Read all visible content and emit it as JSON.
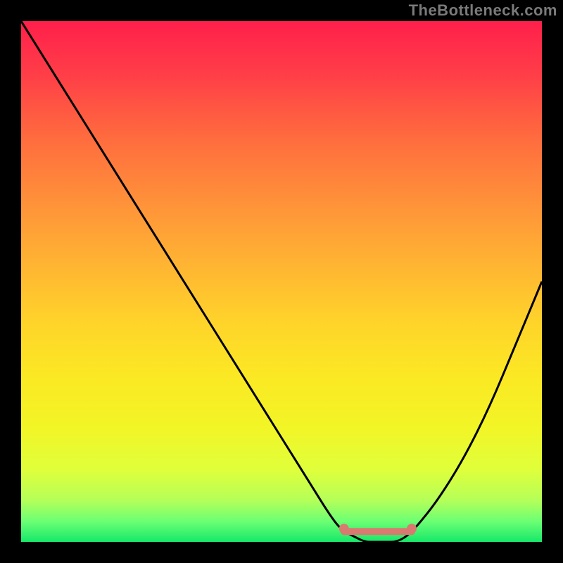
{
  "attribution": "TheBottleneck.com",
  "chart_data": {
    "type": "line",
    "title": "",
    "xlabel": "",
    "ylabel": "",
    "xlim": [
      0,
      100
    ],
    "ylim": [
      0,
      100
    ],
    "x": [
      0,
      5,
      10,
      15,
      20,
      25,
      30,
      35,
      40,
      45,
      50,
      55,
      60,
      62,
      64,
      66,
      68,
      70,
      72,
      74,
      76,
      80,
      85,
      90,
      95,
      100
    ],
    "values": [
      100,
      92,
      84,
      76,
      68,
      60,
      52,
      44,
      36,
      28,
      20,
      12,
      4,
      2,
      1,
      0,
      0,
      0,
      0,
      1,
      3,
      8,
      16,
      26,
      38,
      50
    ],
    "optimal_range": {
      "start": 62,
      "end": 75,
      "value": 2
    },
    "background": "rainbow-vertical-gradient",
    "annotations": []
  },
  "colors": {
    "frame": "#000000",
    "attribution_text": "#7a7a7a",
    "curve": "#000000",
    "flat_marker": "#d97a70"
  }
}
